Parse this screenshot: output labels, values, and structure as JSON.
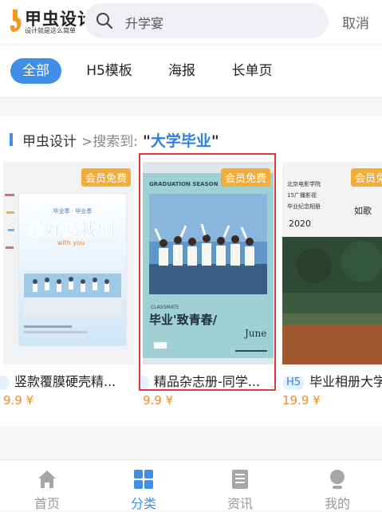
{
  "header": {
    "logo_text": "甲虫设计",
    "logo_sub": "设计就是这么简单",
    "search_value": "升学宴",
    "cancel_label": "取消"
  },
  "tabs": [
    {
      "label": "全部",
      "active": true
    },
    {
      "label": "H5模板",
      "active": false
    },
    {
      "label": "海报",
      "active": false
    },
    {
      "label": "长单页",
      "active": false
    }
  ],
  "breadcrumb": {
    "site": "甲虫设计",
    "sep": ">搜索到:",
    "query_open": "\"",
    "query": "大学毕业",
    "query_close": "\""
  },
  "cards": [
    {
      "badge": "会员免费",
      "tag": "",
      "title": "竖款覆膜硬壳精...",
      "price": "9.9 ¥",
      "cover_title": "最好的我们",
      "cover_en": "with you",
      "cover_top": "毕业季 · 毕业季"
    },
    {
      "badge": "会员免费",
      "tag": "",
      "title": "精品杂志册-同学...",
      "price": "9.9 ¥",
      "cover_header": "GRADUATION SEASON",
      "cover_label": "CLASSMATE",
      "cover_title": "毕业'致青春/",
      "cover_june": "June"
    },
    {
      "badge": "会员免费",
      "tag": "H5",
      "title": "毕业相册大学",
      "price": "19.9 ¥",
      "cover_lines": [
        "北京电影学院",
        "15广播影视",
        "毕业纪念相册"
      ],
      "cover_year": "2020",
      "cover_side": "如歌"
    }
  ],
  "bottom_nav": [
    {
      "label": "首页",
      "icon": "home-icon",
      "active": false
    },
    {
      "label": "分类",
      "icon": "grid-icon",
      "active": true
    },
    {
      "label": "资讯",
      "icon": "news-icon",
      "active": false
    },
    {
      "label": "我的",
      "icon": "profile-icon",
      "active": false
    }
  ],
  "colors": {
    "accent": "#3f8fe8",
    "badge": "#f3ad3a",
    "price": "#f08c2a",
    "highlight_border": "#e03a3a"
  }
}
